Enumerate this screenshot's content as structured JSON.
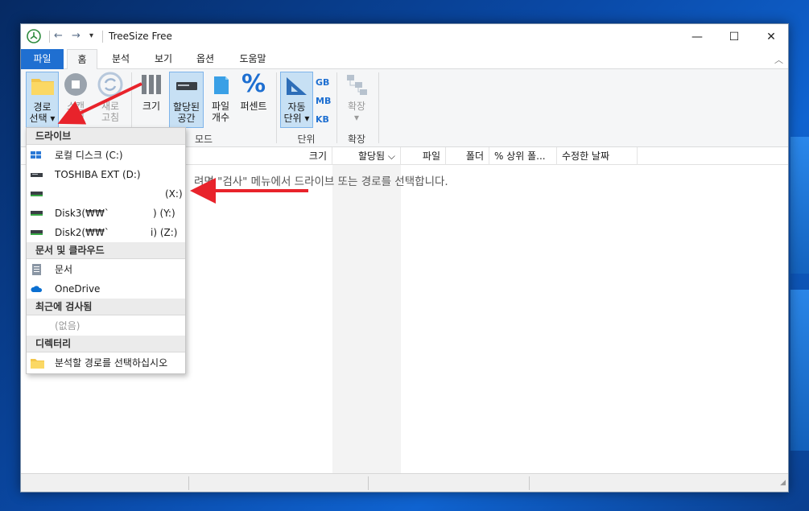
{
  "window": {
    "title": "TreeSize Free"
  },
  "controls": {
    "minimize": "—",
    "maximize": "☐",
    "close": "✕"
  },
  "tabs": [
    {
      "label": "파일",
      "active": false
    },
    {
      "label": "홈",
      "active": true
    },
    {
      "label": "분석",
      "active": false
    },
    {
      "label": "보기",
      "active": false
    },
    {
      "label": "옵션",
      "active": false
    },
    {
      "label": "도움말",
      "active": false
    }
  ],
  "ribbon": {
    "select_dir": {
      "line1": "경로",
      "line2": "선택 ▾"
    },
    "stop": {
      "line1": "스캔",
      "line2": "중지"
    },
    "refresh": {
      "line1": "새로",
      "line2": "고침"
    },
    "size": "크기",
    "allocated": {
      "line1": "할당된",
      "line2": "공간"
    },
    "file_count": {
      "line1": "파일",
      "line2": "개수"
    },
    "percent": "퍼센트",
    "mode_group": "모드",
    "auto_unit": {
      "line1": "자동",
      "line2": "단위 ▾"
    },
    "units": [
      "GB",
      "MB",
      "KB"
    ],
    "unit_group": "단위",
    "expand": {
      "line1": "확장",
      "line2": "▾"
    },
    "expand_group": "확장"
  },
  "columns": [
    "크기",
    "할당됨 ⌵",
    "파일",
    "폴더",
    "% 상위 폴...",
    "수정한 날짜"
  ],
  "message": "려면 \"검사\" 메뉴에서 드라이브 또는 경로를 선택합니다.",
  "dropdown": {
    "drives_header": "드라이브",
    "drives": [
      {
        "label": "로컬 디스크 (C:)",
        "suffix": ""
      },
      {
        "label": "TOSHIBA EXT (D:)",
        "suffix": ""
      },
      {
        "label": "",
        "suffix": "(X:)"
      },
      {
        "label": "Disk3(₩₩`",
        "suffix": ") (Y:)"
      },
      {
        "label": "Disk2(₩₩`",
        "suffix": "i) (Z:)"
      }
    ],
    "docs_header": "문서 및 클라우드",
    "docs": [
      "문서",
      "OneDrive"
    ],
    "recent_header": "최근에 검사됨",
    "recent_empty": "(없음)",
    "dir_header": "디렉터리",
    "dir_item": "분석할 경로를 선택하십시오"
  },
  "colors": {
    "accent": "#1f6fd1",
    "arrow": "#e8232b",
    "selected": "#c7e0f4"
  }
}
